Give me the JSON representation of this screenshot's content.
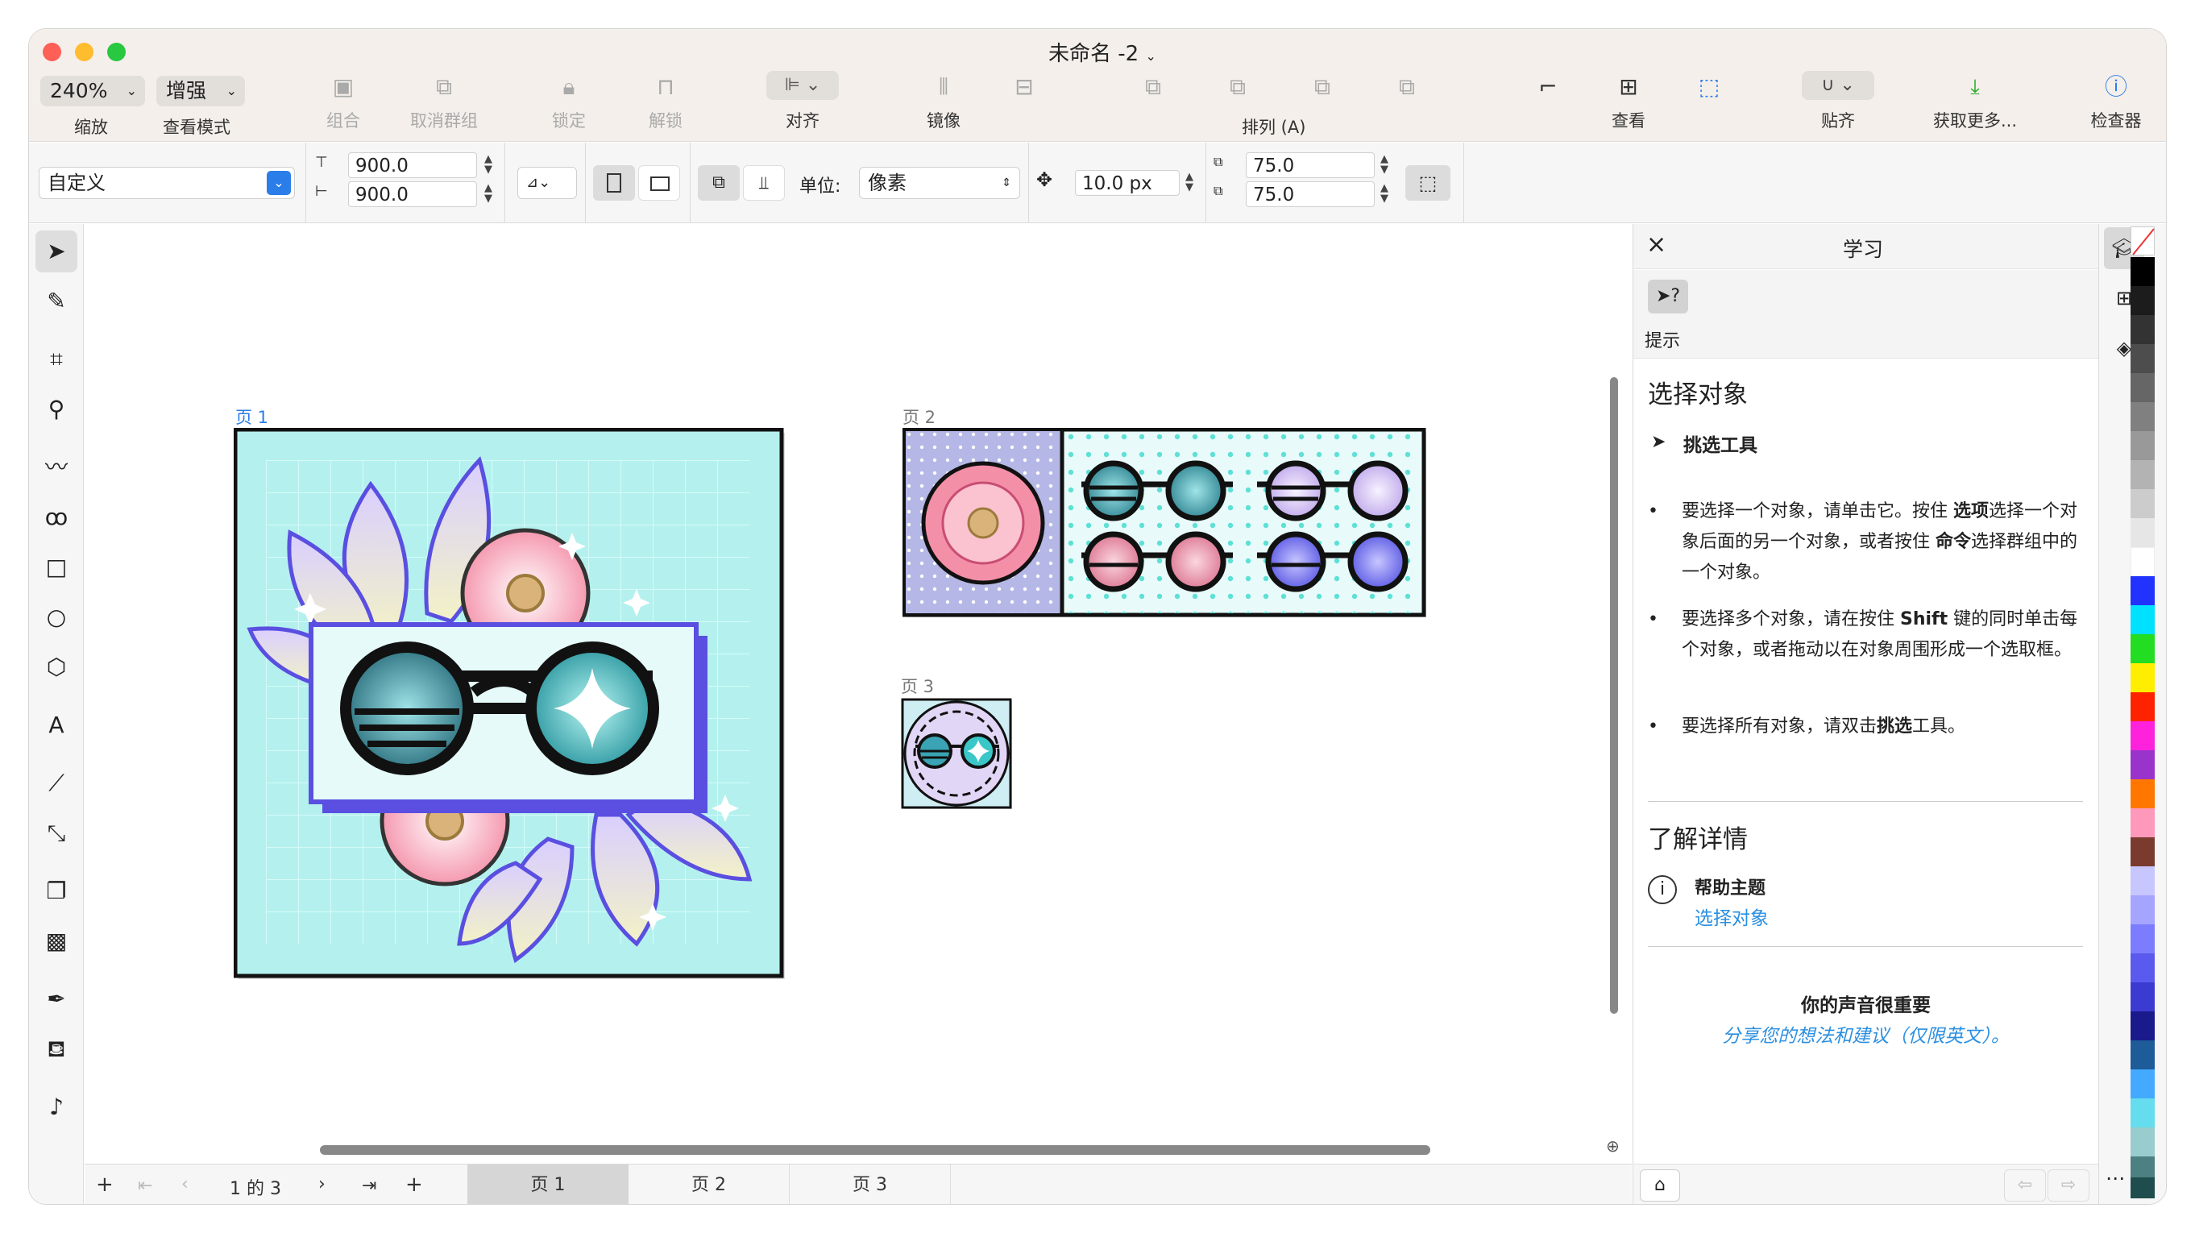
{
  "window": {
    "title": "未命名 -2"
  },
  "toolbar": {
    "zoom_value": "240%",
    "zoom_label": "缩放",
    "viewmode_value": "增强",
    "viewmode_label": "查看模式",
    "group": "组合",
    "ungroup": "取消群组",
    "lock": "锁定",
    "unlock": "解锁",
    "align": "对齐",
    "mirror": "镜像",
    "arrange": "排列 (A)",
    "view": "查看",
    "snap": "贴齐",
    "getmore": "获取更多...",
    "inspector": "检查器"
  },
  "propbar": {
    "preset": "自定义",
    "width": "900.0",
    "height": "900.0",
    "unit_label": "单位:",
    "unit_value": "像素",
    "nudge": "10.0 px",
    "dup_x": "75.0",
    "dup_y": "75.0"
  },
  "pages": {
    "label1": "页 1",
    "label2": "页 2",
    "label3": "页 3"
  },
  "status": {
    "pager": "1 的 3",
    "tab1": "页 1",
    "tab2": "页 2",
    "tab3": "页 3"
  },
  "panel": {
    "title": "学习",
    "hints_label": "提示",
    "section1_title": "选择对象",
    "tool_name": "挑选工具",
    "bullet1_a": "要选择一个对象，请单击它。按住 ",
    "bullet1_b": "选项",
    "bullet1_c": "选择一个对象后面的另一个对象，或者按住 ",
    "bullet1_d": "命令",
    "bullet1_e": "选择群组中的一个对象。",
    "bullet2_a": "要选择多个对象，请在按住 ",
    "bullet2_b": "Shift",
    "bullet2_c": " 键的同时单击每个对象，或者拖动以在对象周围形成一个选取框。",
    "bullet3_a": "要选择所有对象，请双击",
    "bullet3_b": "挑选",
    "bullet3_c": "工具。",
    "section2_title": "了解详情",
    "help_topic": "帮助主题",
    "help_link": "选择对象",
    "feedback_title": "你的声音很重要",
    "feedback_link": "分享您的想法和建议（仅限英文）。"
  },
  "colors": {
    "accent": "#2b7de9",
    "teal": "#b4f1ee",
    "purple": "#5a4fe0"
  }
}
